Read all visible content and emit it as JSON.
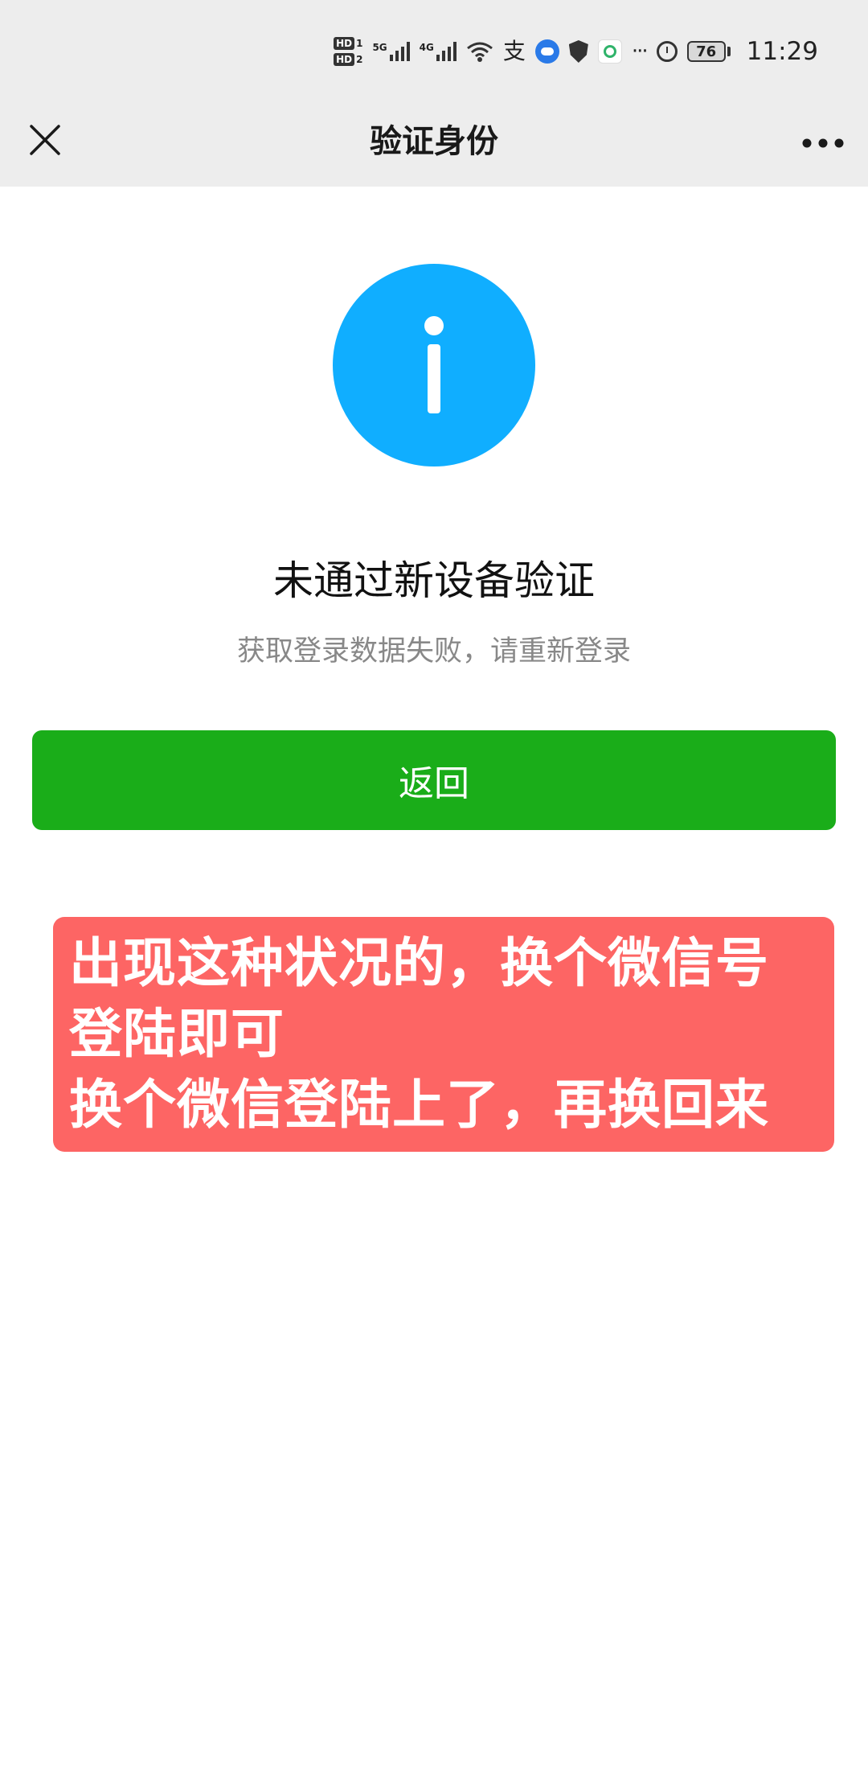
{
  "status_bar": {
    "hd1": "HD",
    "hd1_sub": "1",
    "hd2": "HD",
    "hd2_sub": "2",
    "sim1_network": "5G",
    "sim2_network": "4G",
    "alipay_glyph": "支",
    "more": "···",
    "battery": "76",
    "time": "11:29",
    "icons": [
      "hd-icon",
      "signal-5g-icon",
      "signal-4g-icon",
      "wifi-icon",
      "alipay-icon",
      "cloud-icon",
      "shield-icon",
      "china-mobile-icon",
      "alarm-icon",
      "battery-icon"
    ]
  },
  "navbar": {
    "title": "验证身份",
    "left_icon": "close-icon",
    "right_icon": "more-icon"
  },
  "main": {
    "icon": "info-icon",
    "title": "未通过新设备验证",
    "description": "获取登录数据失败，请重新登录",
    "button_label": "返回"
  },
  "annotation": {
    "line1": "出现这种状况的，换个微信号",
    "line2": "登陆即可",
    "line3": "换个微信登陆上了，再换回来"
  },
  "colors": {
    "bar_background": "#ededed",
    "info_blue": "#10aeff",
    "button_green": "#1aad19",
    "annotation_red": "#fd6564"
  }
}
